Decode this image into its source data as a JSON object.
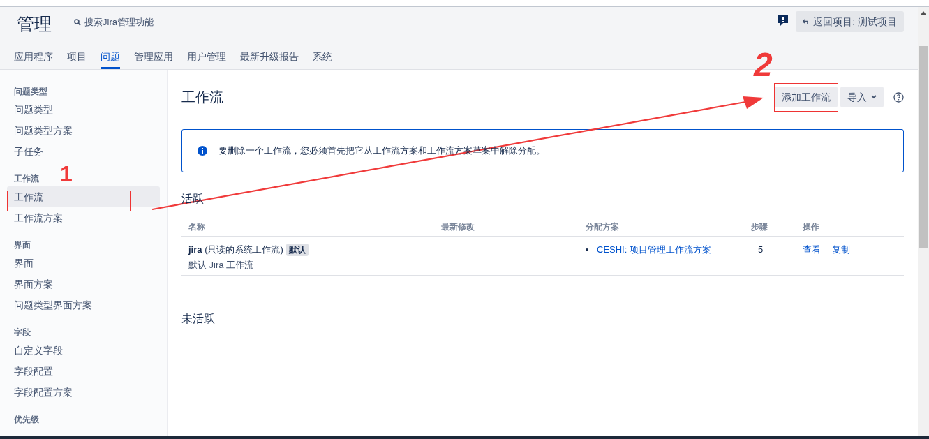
{
  "header": {
    "title": "管理",
    "search": "搜索Jira管理功能",
    "back_button": "返回项目: 测试项目"
  },
  "nav_tabs": [
    {
      "label": "应用程序",
      "selected": false
    },
    {
      "label": "项目",
      "selected": false
    },
    {
      "label": "问题",
      "selected": true
    },
    {
      "label": "管理应用",
      "selected": false
    },
    {
      "label": "用户管理",
      "selected": false
    },
    {
      "label": "最新升级报告",
      "selected": false
    },
    {
      "label": "系统",
      "selected": false
    }
  ],
  "sidebar": [
    {
      "heading": "问题类型",
      "items": [
        {
          "label": "问题类型",
          "selected": false
        },
        {
          "label": "问题类型方案",
          "selected": false
        },
        {
          "label": "子任务",
          "selected": false
        }
      ]
    },
    {
      "heading": "工作流",
      "items": [
        {
          "label": "工作流",
          "selected": true
        },
        {
          "label": "工作流方案",
          "selected": false
        }
      ]
    },
    {
      "heading": "界面",
      "items": [
        {
          "label": "界面",
          "selected": false
        },
        {
          "label": "界面方案",
          "selected": false
        },
        {
          "label": "问题类型界面方案",
          "selected": false
        }
      ]
    },
    {
      "heading": "字段",
      "items": [
        {
          "label": "自定义字段",
          "selected": false
        },
        {
          "label": "字段配置",
          "selected": false
        },
        {
          "label": "字段配置方案",
          "selected": false
        }
      ]
    },
    {
      "heading": "优先级"
    }
  ],
  "page": {
    "title": "工作流",
    "add_button": "添加工作流",
    "import_button": "导入",
    "info_message": "要删除一个工作流，您必须首先把它从工作流方案和工作流方案草案中解除分配。",
    "active": {
      "title": "活跃",
      "columns": [
        "名称",
        "最新修改",
        "分配方案",
        "步骤",
        "操作"
      ],
      "rows": [
        {
          "name": "jira",
          "note": "(只读的系统工作流)",
          "badge": "默认",
          "description": "默认 Jira 工作流",
          "schemes": [
            "CESHI: 项目管理工作流方案"
          ],
          "steps": "5",
          "actions": [
            "查看",
            "复制"
          ]
        }
      ]
    },
    "inactive": {
      "title": "未活跃"
    }
  },
  "annotations": [
    {
      "label": "1"
    },
    {
      "label": "2"
    }
  ]
}
